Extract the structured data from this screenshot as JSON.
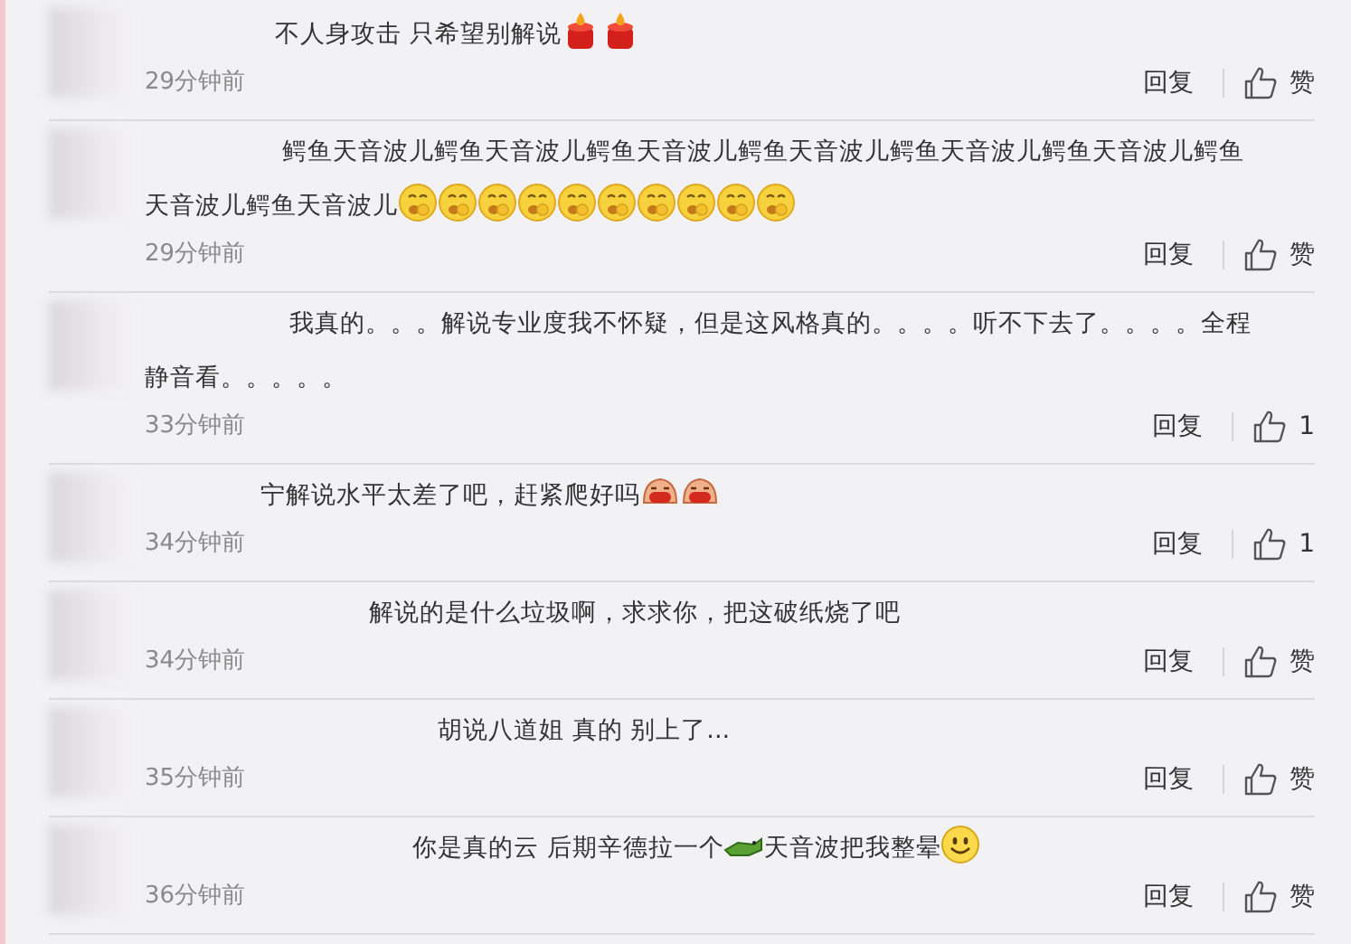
{
  "comments": [
    {
      "lines": [
        [
          {
            "kind": "text",
            "text": "不人身攻击 只希望别解说"
          },
          {
            "kind": "candle"
          },
          {
            "kind": "candle"
          }
        ]
      ],
      "time": "29分钟前",
      "reply": "回复",
      "like": "赞"
    },
    {
      "lines": [
        [
          {
            "kind": "text",
            "text": "鳄鱼天音波儿鳄鱼天音波儿鳄鱼天音波儿鳄鱼天音波儿鳄鱼天音波儿鳄鱼天音波儿鳄鱼"
          }
        ],
        [
          {
            "kind": "text",
            "text": "天音波儿鳄鱼天音波儿"
          },
          {
            "kind": "yawn"
          },
          {
            "kind": "yawn"
          },
          {
            "kind": "yawn"
          },
          {
            "kind": "yawn"
          },
          {
            "kind": "yawn"
          },
          {
            "kind": "yawn"
          },
          {
            "kind": "yawn"
          },
          {
            "kind": "yawn"
          },
          {
            "kind": "yawn"
          },
          {
            "kind": "yawn"
          }
        ]
      ],
      "time": "29分钟前",
      "reply": "回复",
      "like": "赞"
    },
    {
      "lines": [
        [
          {
            "kind": "text",
            "text": "我真的。。。解说专业度我不怀疑，但是这风格真的。。。。听不下去了。。。。全程"
          }
        ],
        [
          {
            "kind": "text",
            "text": "静音看。。。。。"
          }
        ]
      ],
      "time": "33分钟前",
      "reply": "回复",
      "like": "1"
    },
    {
      "lines": [
        [
          {
            "kind": "text",
            "text": "宁解说水平太差了吧，赶紧爬好吗"
          },
          {
            "kind": "laugh"
          },
          {
            "kind": "laugh"
          }
        ]
      ],
      "time": "34分钟前",
      "reply": "回复",
      "like": "1"
    },
    {
      "lines": [
        [
          {
            "kind": "text",
            "text": "解说的是什么垃圾啊，求求你，把这破纸烧了吧"
          }
        ]
      ],
      "time": "34分钟前",
      "reply": "回复",
      "like": "赞"
    },
    {
      "lines": [
        [
          {
            "kind": "text",
            "text": "胡说八道姐 真的 别上了..."
          }
        ]
      ],
      "time": "35分钟前",
      "reply": "回复",
      "like": "赞"
    },
    {
      "lines": [
        [
          {
            "kind": "text",
            "text": "你是真的云 后期辛德拉一个"
          },
          {
            "kind": "crocodile"
          },
          {
            "kind": "text",
            "text": "天音波把我整晕"
          },
          {
            "kind": "smile"
          }
        ]
      ],
      "time": "36分钟前",
      "reply": "回复",
      "like": "赞"
    }
  ]
}
